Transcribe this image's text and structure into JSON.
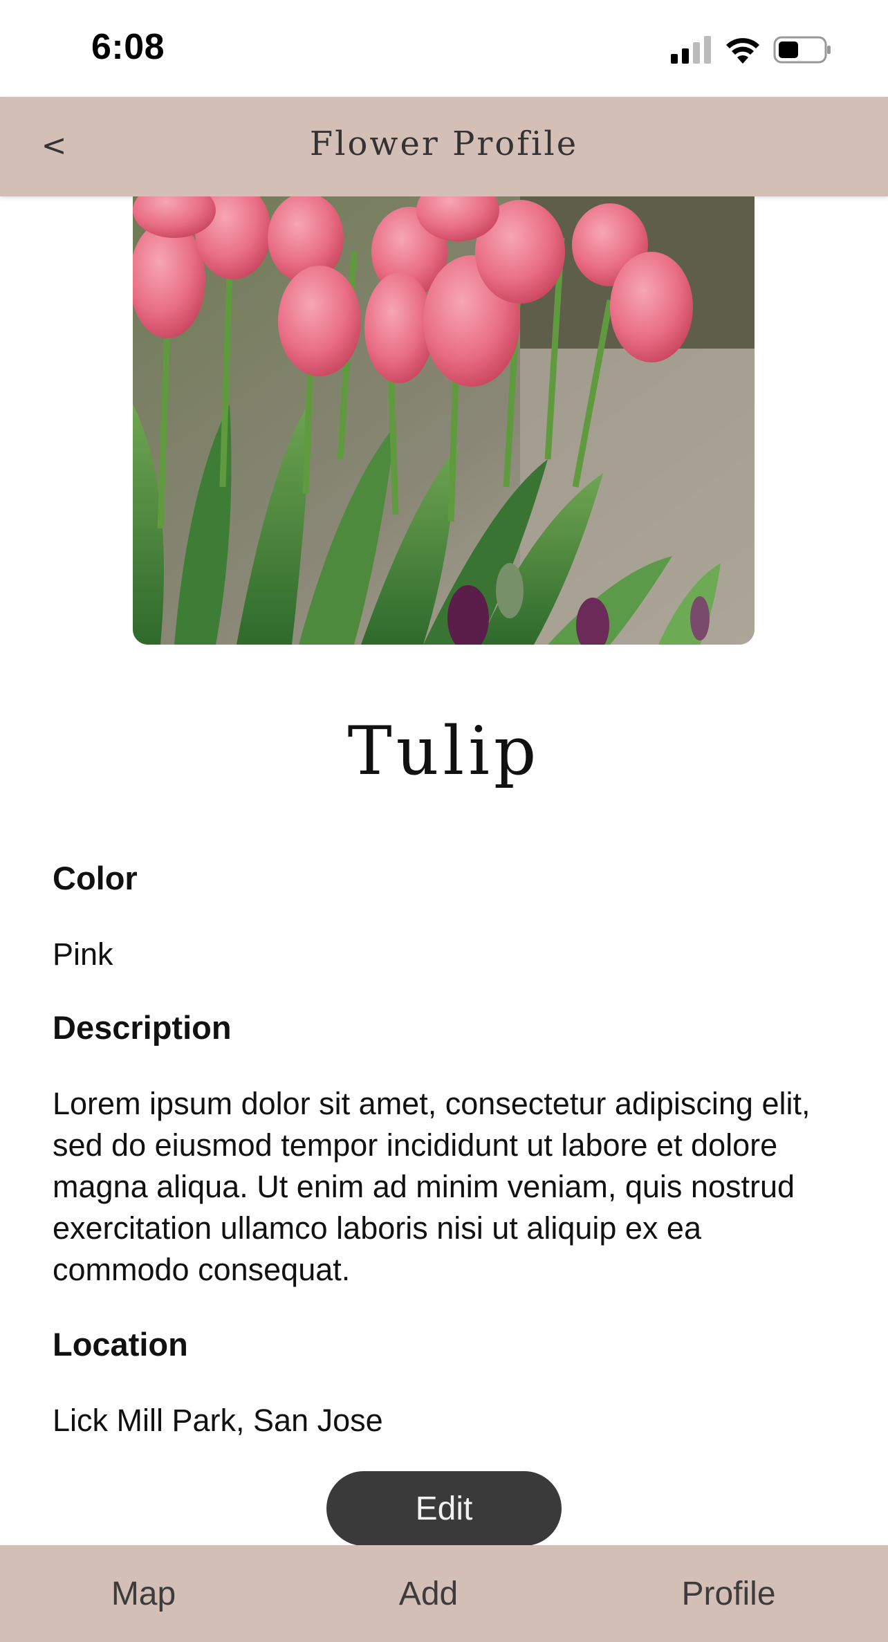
{
  "status_bar": {
    "time": "6:08",
    "icons": [
      "cellular-signal-icon",
      "wifi-icon",
      "battery-icon"
    ]
  },
  "header": {
    "back_label": "<",
    "title": "Flower Profile"
  },
  "hero_image": {
    "subject": "pink-tulips-photo"
  },
  "flower": {
    "name": "Tulip",
    "color_label": "Color",
    "color_value": "Pink",
    "description_label": "Description",
    "description_value": "Lorem ipsum dolor sit amet, consectetur adipiscing elit, sed do eiusmod tempor incididunt ut labore et dolore magna aliqua. Ut enim ad minim veniam, quis nostrud exercitation ullamco laboris nisi ut aliquip ex ea commodo consequat.",
    "location_label": "Location",
    "location_value": "Lick Mill Park, San Jose"
  },
  "actions": {
    "edit_label": "Edit"
  },
  "bottom_nav": {
    "items": [
      {
        "label": "Map"
      },
      {
        "label": "Add"
      },
      {
        "label": "Profile"
      }
    ]
  },
  "colors": {
    "nav_background": "#d4bfb6",
    "button_background": "#3a3a3a",
    "text": "#111111"
  }
}
